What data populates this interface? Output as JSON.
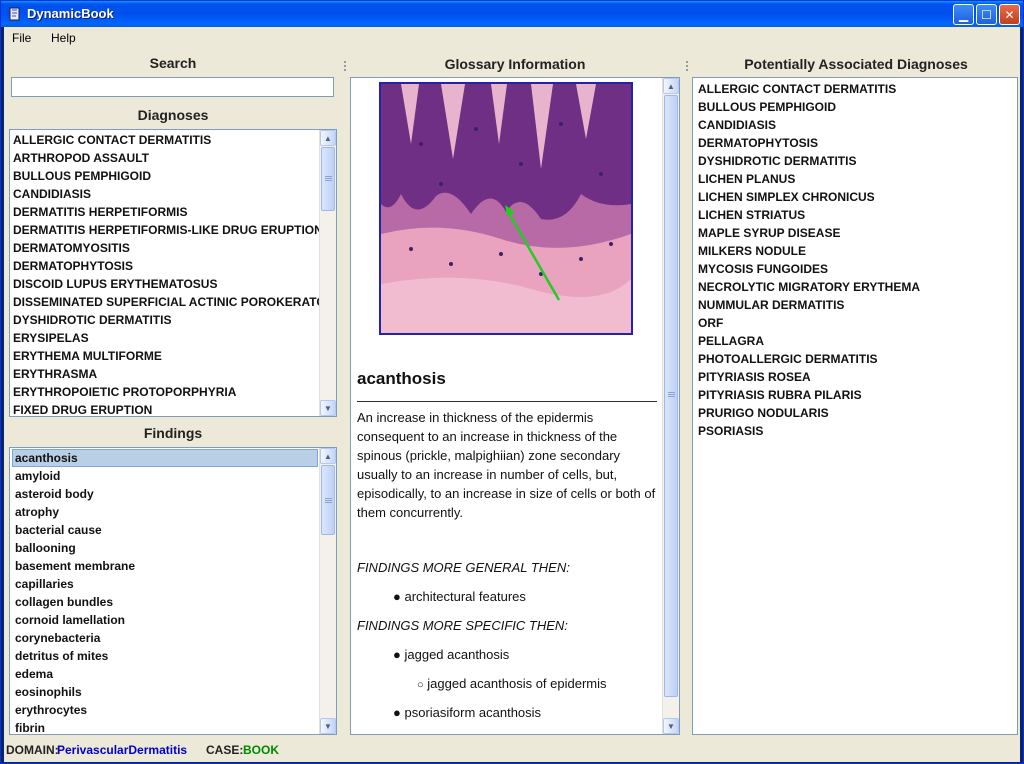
{
  "window": {
    "title": "DynamicBook"
  },
  "menu": {
    "file": "File",
    "help": "Help"
  },
  "search": {
    "header": "Search",
    "value": ""
  },
  "diagnoses": {
    "header": "Diagnoses",
    "items": [
      "ALLERGIC CONTACT DERMATITIS",
      "ARTHROPOD ASSAULT",
      "BULLOUS PEMPHIGOID",
      "CANDIDIASIS",
      "DERMATITIS HERPETIFORMIS",
      "DERMATITIS HERPETIFORMIS-LIKE DRUG ERUPTION",
      "DERMATOMYOSITIS",
      "DERMATOPHYTOSIS",
      "DISCOID LUPUS ERYTHEMATOSUS",
      "DISSEMINATED SUPERFICIAL ACTINIC POROKERATOSIS",
      "DYSHIDROTIC DERMATITIS",
      "ERYSIPELAS",
      "ERYTHEMA MULTIFORME",
      "ERYTHRASMA",
      "ERYTHROPOIETIC PROTOPORPHYRIA",
      "FIXED DRUG ERUPTION"
    ]
  },
  "findings": {
    "header": "Findings",
    "selected_index": 0,
    "items": [
      "acanthosis",
      "amyloid",
      "asteroid body",
      "atrophy",
      "bacterial cause",
      "ballooning",
      "basement membrane",
      "capillaries",
      "collagen bundles",
      "cornoid lamellation",
      "corynebacteria",
      "detritus of mites",
      "edema",
      "eosinophils",
      "erythrocytes",
      "fibrin"
    ]
  },
  "glossary": {
    "header": "Glossary Information",
    "term": "acanthosis",
    "definition": "An increase in thickness of the epidermis consequent to an increase in thickness of the spinous (prickle, malpighiian) zone secondary usually to an increase in number of cells, but, episodically, to an increase in size of cells or both of them concurrently.",
    "general_header": "FINDINGS MORE GENERAL THEN:",
    "general_items": [
      "architectural features"
    ],
    "specific_header": "FINDINGS MORE SPECIFIC THEN:",
    "specific_items": [
      "jagged acanthosis",
      "jagged acanthosis of epidermis",
      "psoriasiform acanthosis"
    ]
  },
  "associated": {
    "header": "Potentially Associated Diagnoses",
    "items": [
      "ALLERGIC CONTACT DERMATITIS",
      "BULLOUS PEMPHIGOID",
      "CANDIDIASIS",
      "DERMATOPHYTOSIS",
      "DYSHIDROTIC DERMATITIS",
      "LICHEN PLANUS",
      "LICHEN SIMPLEX CHRONICUS",
      "LICHEN STRIATUS",
      "MAPLE SYRUP DISEASE",
      "MILKERS NODULE",
      "MYCOSIS FUNGOIDES",
      "NECROLYTIC MIGRATORY ERYTHEMA",
      "NUMMULAR DERMATITIS",
      "ORF",
      "PELLAGRA",
      "PHOTOALLERGIC DERMATITIS",
      "PITYRIASIS ROSEA",
      "PITYRIASIS RUBRA PILARIS",
      "PRURIGO NODULARIS",
      "PSORIASIS"
    ]
  },
  "status": {
    "domain_label": "DOMAIN:",
    "domain_value": "PerivascularDermatitis",
    "case_label": "CASE:",
    "case_value": "BOOK"
  },
  "colors": {
    "domain_value": "#0000cc",
    "case_value": "#008800",
    "arrow": "#22cc22"
  }
}
